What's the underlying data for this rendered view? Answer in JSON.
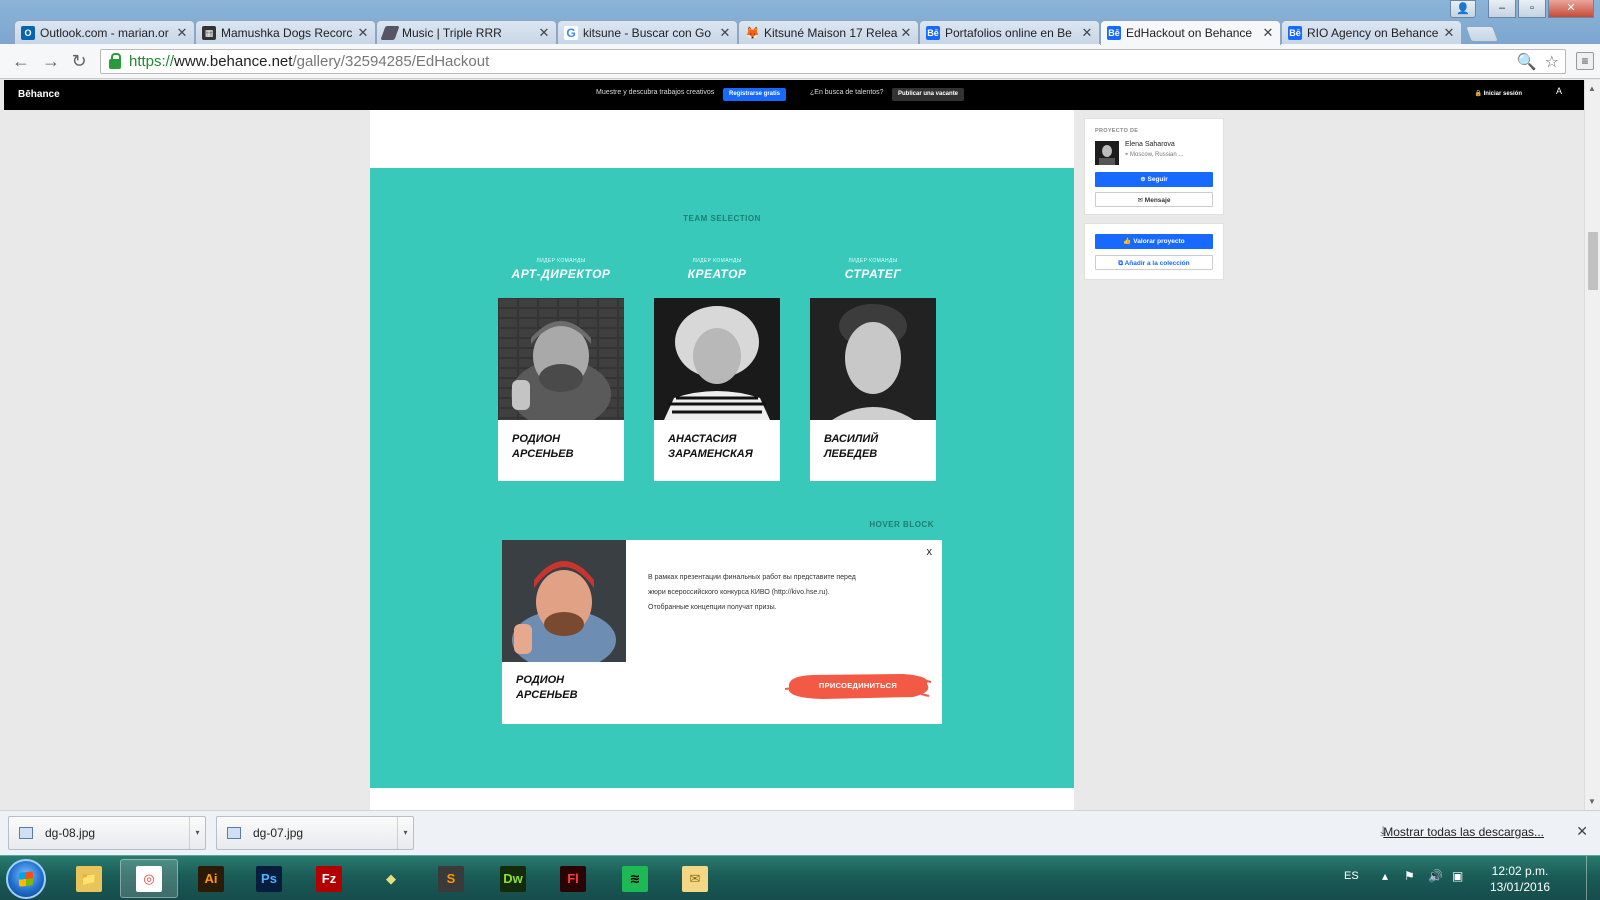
{
  "browser": {
    "tabs": [
      {
        "title": "Outlook.com - marian.or",
        "icon": "outlook-icon",
        "color": "#0a64ad"
      },
      {
        "title": "Mamushka Dogs Recorc",
        "icon": "clapper-icon",
        "color": "#333333"
      },
      {
        "title": "Music | Triple RRR",
        "icon": "music-icon",
        "color": "#555555"
      },
      {
        "title": "kitsune - Buscar con Go",
        "icon": "google-icon",
        "color": "#4285f4"
      },
      {
        "title": "Kitsuné Maison 17 Relea",
        "icon": "fox-icon",
        "color": "#333333"
      },
      {
        "title": "Portafolios online en Be",
        "icon": "behance-icon",
        "color": "#1769ff"
      },
      {
        "title": "EdHackout on Behance",
        "icon": "behance-icon",
        "color": "#1769ff",
        "active": true
      },
      {
        "title": "RIO Agency on Behance",
        "icon": "behance-icon",
        "color": "#1769ff"
      }
    ],
    "url_protocol": "https://",
    "url_host": "www.behance.net",
    "url_path": "/gallery/32594285/EdHackout"
  },
  "behance_bar": {
    "logo": "Bēhance",
    "promo_text": "Muestre y descubra trabajos creativos",
    "signup_button": "Registrarse gratis",
    "talent_text": "¿En busca de talentos?",
    "post_job_button": "Publicar una vacante",
    "login": "🔒 Iniciar sesión",
    "adobe": "A"
  },
  "project": {
    "section_title": "TEAM SELECTION",
    "team": [
      {
        "lead": "ЛИДЕР КОМАНДЫ",
        "role": "АРТ-ДИРЕКТОР",
        "name_line1": "РОДИОН",
        "name_line2": "АРСЕНЬЕВ"
      },
      {
        "lead": "ЛИДЕР КОМАНДЫ",
        "role": "КРЕАТОР",
        "name_line1": "АНАСТАСИЯ",
        "name_line2": "ЗАРАМЕНСКАЯ"
      },
      {
        "lead": "ЛИДЕР КОМАНДЫ",
        "role": "СТРАТЕГ",
        "name_line1": "ВАСИЛИЙ",
        "name_line2": "ЛЕБЕДЕВ"
      }
    ],
    "hover_block_label": "HOVER BLOCK",
    "hover_card": {
      "name_line1": "РОДИОН",
      "name_line2": "АРСЕНЬЕВ",
      "close": "x",
      "text_line1": "В рамках презентации финальных работ вы представите перед",
      "text_line2": "жюри всероссийского конкурса КИВО (http://kivo.hse.ru).",
      "text_line3": "Отобранные концепции получат призы.",
      "join_button": "ПРИСОЕДИНИТЬСЯ"
    },
    "colors": {
      "teal": "#38c9bb",
      "join": "#f25a45",
      "behance_blue": "#1769ff"
    }
  },
  "sidebar": {
    "owner_label": "PROYECTO DE",
    "owner_name": "Elena Saharova",
    "owner_location": "Moscow, Russian ...",
    "follow_button": "Seguir",
    "message_button": "Mensaje",
    "appreciate_button": "Valorar proyecto",
    "collection_button": "Añadir a la colección"
  },
  "downloads": {
    "items": [
      {
        "filename": "dg-08.jpg"
      },
      {
        "filename": "dg-07.jpg"
      }
    ],
    "show_all": "Mostrar todas las descargas..."
  },
  "taskbar": {
    "apps": [
      {
        "name": "explorer",
        "label": "📁",
        "bg": "#e8c45a",
        "fg": "#7a5a10"
      },
      {
        "name": "chrome",
        "label": "◎",
        "bg": "#ffffff",
        "fg": "#db4437",
        "active": true
      },
      {
        "name": "illustrator",
        "label": "Ai",
        "bg": "#2b1a05",
        "fg": "#ff9a00"
      },
      {
        "name": "photoshop",
        "label": "Ps",
        "bg": "#061e3b",
        "fg": "#4fb3ff"
      },
      {
        "name": "filezilla",
        "label": "Fz",
        "bg": "#b30000",
        "fg": "#ffffff"
      },
      {
        "name": "sketchup",
        "label": "◆",
        "bg": "transparent",
        "fg": "#e6e07a"
      },
      {
        "name": "sublime",
        "label": "S",
        "bg": "#3a3a3a",
        "fg": "#ff9800"
      },
      {
        "name": "dreamweaver",
        "label": "Dw",
        "bg": "#132a0b",
        "fg": "#8ee02f"
      },
      {
        "name": "flash",
        "label": "Fl",
        "bg": "#2a0404",
        "fg": "#ff3b3b"
      },
      {
        "name": "spotify",
        "label": "≋",
        "bg": "#1db954",
        "fg": "#000000"
      },
      {
        "name": "mail",
        "label": "✉",
        "bg": "#f4d784",
        "fg": "#8a6a1a"
      }
    ],
    "language": "ES",
    "time": "12:02 p.m.",
    "date": "13/01/2016"
  }
}
